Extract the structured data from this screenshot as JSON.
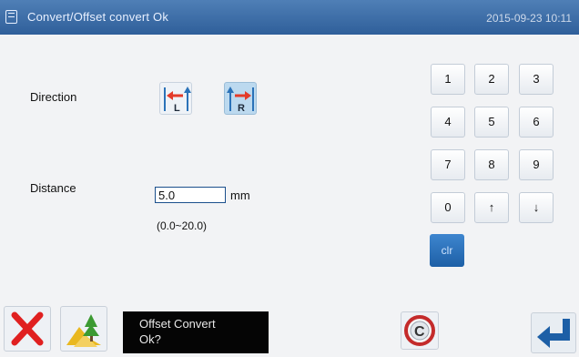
{
  "header": {
    "title": "Convert/Offset convert  Ok",
    "datetime": "2015-09-23 10:11"
  },
  "form": {
    "direction_label": "Direction",
    "direction_left_glyph": "L",
    "direction_right_glyph": "R",
    "direction_selected": "R",
    "distance_label": "Distance",
    "distance_value": "5.0",
    "distance_unit": "mm",
    "distance_range": "(0.0~20.0)"
  },
  "keypad": {
    "keys": [
      "1",
      "2",
      "3",
      "4",
      "5",
      "6",
      "7",
      "8",
      "9",
      "0",
      "↑",
      "↓"
    ],
    "clear_label": "clr"
  },
  "footer": {
    "message_line1": "Offset Convert",
    "message_line2": "Ok?",
    "c_label": "C"
  },
  "colors": {
    "titlebar": "#2f5f9a",
    "accent_blue": "#1d5fa6",
    "cancel_red": "#e02020",
    "arrow_red": "#e43b2a"
  }
}
